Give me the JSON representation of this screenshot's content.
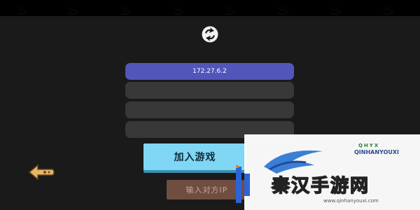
{
  "server_form": {
    "fields": [
      {
        "value": "172.27.6.2",
        "placeholder": ""
      },
      {
        "value": "",
        "placeholder": ""
      },
      {
        "value": "",
        "placeholder": ""
      },
      {
        "value": "",
        "placeholder": ""
      }
    ]
  },
  "actions": {
    "join_label": "加入游戏",
    "peer_label": "输入对方IP"
  },
  "icons": {
    "logo": "game-logo-icon",
    "back": "back-arrow-icon"
  },
  "watermark": {
    "brand_top": "QHYX",
    "brand_name": "QINHANYOUXI",
    "chinese": "秦汉手游网",
    "url": "www.qinhanyouxi.com"
  },
  "colors": {
    "panel": "#1a1a1a",
    "input_active": "#5256ba",
    "input": "#383838",
    "join_button": "#7fd7f5",
    "peer_button": "#7a5346",
    "back_icon": "#e8b766"
  }
}
